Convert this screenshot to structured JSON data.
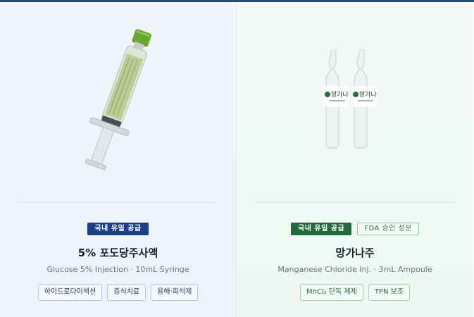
{
  "products": [
    {
      "badges": [
        "국내 유일 공급"
      ],
      "name": "5% 포도당주사액",
      "subtitle": "Glucose 5% Injection · 10mL Syringe",
      "tags": [
        "하이드로다이섹션",
        "증식치료",
        "용해·희석제"
      ],
      "image": "syringe"
    },
    {
      "badges": [
        "국내 유일 공급",
        "FDA 승인 성분"
      ],
      "name": "망가나주",
      "subtitle": "Manganese Chloride Inj. · 3mL Ampoule",
      "tags": [
        "MnCl₂ 단독 제제",
        "TPN 보조"
      ],
      "image": "ampoules",
      "ampoule_label": "망가나"
    }
  ]
}
